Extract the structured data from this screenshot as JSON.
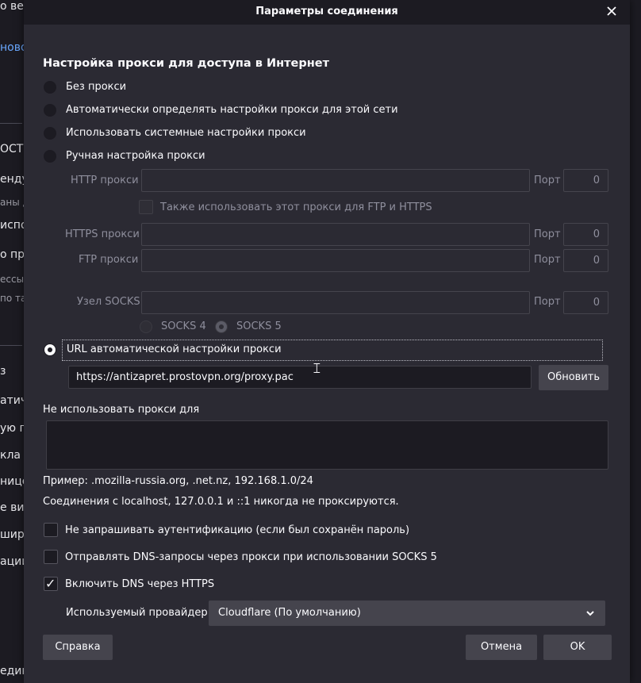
{
  "background": {
    "fragments": [
      "о вер",
      "ново",
      "ОСТ",
      "енду",
      "аны д",
      "испо",
      "о про",
      "ессы",
      "по так",
      "з",
      "атич",
      "ую п",
      "кла",
      "ницё",
      "е ви",
      "шире",
      "ации",
      "един"
    ]
  },
  "dialog": {
    "title": "Параметры соединения",
    "close_icon": "close-icon",
    "heading": "Настройка прокси для доступа в Интернет",
    "options": [
      {
        "label": "Без прокси",
        "selected": false
      },
      {
        "label": "Автоматически определять настройки прокси для этой сети",
        "selected": false
      },
      {
        "label": "Использовать системные настройки прокси",
        "selected": false
      },
      {
        "label": "Ручная настройка прокси",
        "selected": false
      }
    ],
    "manual": {
      "http_label": "HTTP прокси",
      "port_label": "Порт",
      "http_port": "0",
      "also_use_label": "Также использовать этот прокси для FTP и HTTPS",
      "https_label": "HTTPS прокси",
      "https_port": "0",
      "ftp_label": "FTP прокси",
      "ftp_port": "0",
      "socks_label": "Узел SOCKS",
      "socks_port": "0",
      "socks4_label": "SOCKS 4",
      "socks5_label": "SOCKS 5"
    },
    "pac": {
      "label": "URL автоматической настройки прокси",
      "selected": true,
      "url": "https://antizapret.prostovpn.org/proxy.pac",
      "reload_label": "Обновить"
    },
    "no_proxy": {
      "label": "Не использовать прокси для",
      "value": "",
      "example": "Пример: .mozilla-russia.org, .net.nz, 192.168.1.0/24",
      "localhost_note": "Соединения с localhost, 127.0.0.1 и ::1 никогда не проксируются."
    },
    "checkboxes": [
      {
        "label": "Не запрашивать аутентификацию (если был сохранён пароль)",
        "checked": false
      },
      {
        "label": "Отправлять DNS-запросы через прокси при использовании SOCKS 5",
        "checked": false
      },
      {
        "label": "Включить DNS через HTTPS",
        "checked": true
      }
    ],
    "provider": {
      "label": "Используемый провайдер",
      "value": "Cloudflare (По умолчанию)"
    },
    "buttons": {
      "help": "Справка",
      "cancel": "Отмена",
      "ok": "OK"
    }
  }
}
